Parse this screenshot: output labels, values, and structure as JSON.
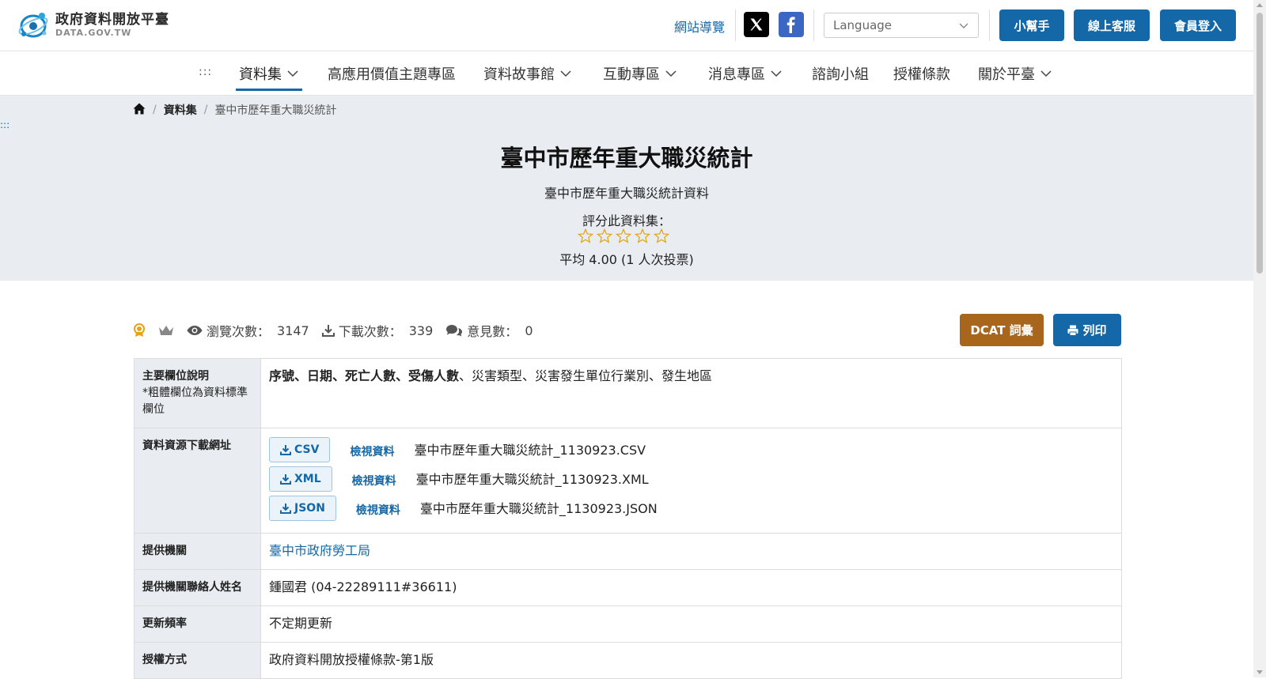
{
  "header": {
    "logo_cn": "政府資料開放平臺",
    "logo_en": "DATA.GOV.TW",
    "sitemap": "網站導覽",
    "language_placeholder": "Language",
    "buttons": [
      "小幫手",
      "線上客服",
      "會員登入"
    ],
    "colors": {
      "primary": "#1468a8",
      "x": "#000000",
      "facebook": "#3b66c4"
    }
  },
  "nav": {
    "accesskey": ":::",
    "items": [
      {
        "label": "資料集",
        "dropdown": true,
        "active": true
      },
      {
        "label": "高應用價值主題專區",
        "dropdown": false
      },
      {
        "label": "資料故事館",
        "dropdown": true
      },
      {
        "label": "互動專區",
        "dropdown": true
      },
      {
        "label": "消息專區",
        "dropdown": true
      },
      {
        "label": "諮詢小組",
        "dropdown": false
      },
      {
        "label": "授權條款",
        "dropdown": false
      },
      {
        "label": "關於平臺",
        "dropdown": true
      }
    ]
  },
  "breadcrumb": {
    "home_icon": "home-icon",
    "section": "資料集",
    "current": "臺中市歷年重大職災統計"
  },
  "left_accesskey": ":::",
  "dataset": {
    "title": "臺中市歷年重大職災統計",
    "subtitle": "臺中市歷年重大職災統計資料",
    "rate_label": "評分此資料集：",
    "stars_total": 5,
    "stars_filled": 0,
    "rating_summary": "平均 4.00 (1 人次投票)"
  },
  "stats": {
    "views_label": "瀏覽次數：",
    "views": "3147",
    "downloads_label": "下載次數：",
    "downloads": "339",
    "comments_label": "意見數：",
    "comments": "0",
    "dcat_label": "DCAT 詞彙",
    "print_label": "列印",
    "colors": {
      "dcat": "#a8661c",
      "badge": "#e8a21a"
    }
  },
  "table": {
    "fields_label": "主要欄位說明",
    "fields_note": "*粗體欄位為資料標準欄位",
    "fields_bold": "序號、日期、死亡人數、受傷人數",
    "fields_rest": "、災害類型、災害發生單位行業別、發生地區",
    "resources_label": "資料資源下載網址",
    "view_label": "檢視資料",
    "resources": [
      {
        "format": "CSV",
        "name": "臺中市歷年重大職災統計_1130923.CSV"
      },
      {
        "format": "XML",
        "name": "臺中市歷年重大職災統計_1130923.XML"
      },
      {
        "format": "JSON",
        "name": "臺中市歷年重大職災統計_1130923.JSON"
      }
    ],
    "provider_label": "提供機關",
    "provider": "臺中市政府勞工局",
    "contact_label": "提供機關聯絡人姓名",
    "contact": "鍾國君 (04-22289111#36611)",
    "frequency_label": "更新頻率",
    "frequency": "不定期更新",
    "license_label": "授權方式",
    "license": "政府資料開放授權條款-第1版"
  }
}
